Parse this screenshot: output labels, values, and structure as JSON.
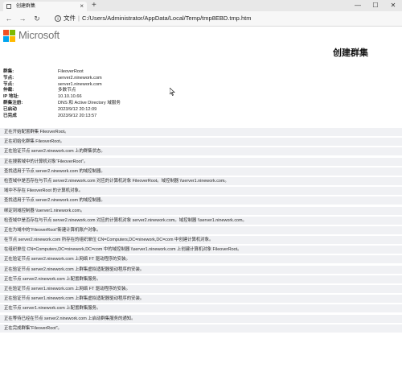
{
  "browser": {
    "tab_title": "创建群集",
    "tab_close": "×",
    "new_tab": "+",
    "window_minimize": "—",
    "window_maximize": "☐",
    "window_close": "✕",
    "back": "←",
    "forward": "→",
    "reload": "↻",
    "info_glyph": "i",
    "address_label": "文件",
    "address_sep": "|",
    "address_url": "C:/Users/Administrator/AppData/Local/Temp/tmp8EBD.tmp.htm"
  },
  "logo": {
    "text": "Microsoft",
    "colors": [
      "#f25022",
      "#7fba00",
      "#00a4ef",
      "#ffb900"
    ]
  },
  "report": {
    "title": "创建群集",
    "properties": [
      {
        "label": "群集:",
        "value": "FileoverRoot"
      },
      {
        "label": "节点:",
        "value": "server2.ninework.com"
      },
      {
        "label": "节点:",
        "value": "server1.ninework.com"
      },
      {
        "label": "仲裁:",
        "value": "多数节点"
      },
      {
        "label": "IP 地址:",
        "value": "10.10.10.66"
      },
      {
        "label": "群集注册:",
        "value": "DNS 和 Active Directory 域服务"
      },
      {
        "label": "已启动",
        "value": "2023/9/12 20:12:09"
      },
      {
        "label": "已完成",
        "value": "2023/9/12 20:13:57"
      }
    ],
    "log": [
      "正在开始配置群集 FileoverRoot。",
      "正在初始化群集 FileoverRoot。",
      "正在验证节点 server2.ninework.com 上的群集状态。",
      "正在搜索域中的计算机对象“FileoverRoot”。",
      "查找适用于节点 server2.ninework.com 的域控制器。",
      "检查域中是否存在与节点 server2.ninework.com 对应的计算机对象 FileoverRoot。域控制器 \\\\server1.ninework.com。",
      "域中不存在 FileoverRoot 的计算机对象。",
      "查找适用于节点 server2.ninework.com 的域控制器。",
      "绑定到域控制器 \\\\server1.ninework.com。",
      "检查域中是否存在与节点 server2.ninework.com 对应的计算机对象 server2.ninework.com。域控制器 \\\\server1.ninework.com。",
      "正在为域中的“FileoverRoot”新建计算机账户对象。",
      "在节点 server2.ninework.com 所存在的组织单位 CN=Computers,DC=ninework,DC=com 中创建计算机对象。",
      "在组织单位 CN=Computers,DC=ninework,DC=com 中的域控制器 \\\\server1.ninework.com 上创建计算机对象 FileoverRoot。",
      "正在验证节点 server2.ninework.com 上网络 FT 驱动程序的安装。",
      "正在验证节点 server2.ninework.com 上群集虚拟适配器驱动程序的安装。",
      "正在节点 server2.ninework.com 上配置群集服务。",
      "正在验证节点 server1.ninework.com 上网络 FT 驱动程序的安装。",
      "正在验证节点 server1.ninework.com 上群集虚拟适配器驱动程序的安装。",
      "正在节点 server1.ninework.com 上配置群集服务。",
      "正在等待已经在节点 server2.ninework.com 上启动群集服务的通知。",
      "正在完成群集“FileoverRoot”。"
    ]
  }
}
